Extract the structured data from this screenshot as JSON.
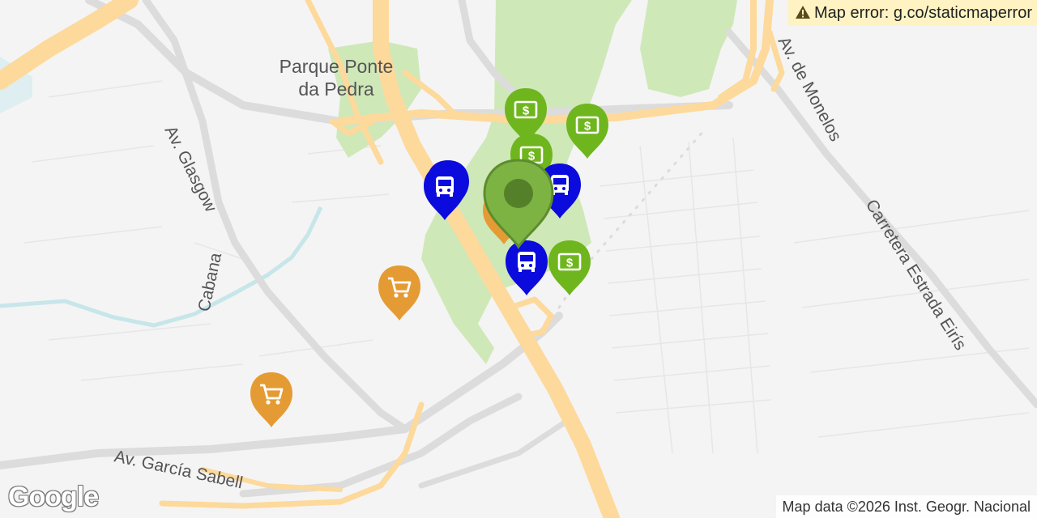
{
  "map": {
    "error_text": "Map error: g.co/staticmaperror",
    "attribution": "Map data ©2026 Inst. Geogr. Nacional",
    "logo_text": "Google",
    "park_label_line1": "Parque Ponte",
    "park_label_line2": "da Pedra",
    "streets": {
      "glasgow": "Av. Glasgow",
      "cabana": "Cabana",
      "garcia_sabell": "Av. García Sabell",
      "monelos": "Av. de Monelos",
      "eiris": "Carretera Estrada Eirís"
    },
    "colors": {
      "background": "#f4f4f4",
      "park": "#cfe8b8",
      "major_road": "#fdd99b",
      "minor_road": "#dcdcdc",
      "water": "#c7e6ea",
      "selected_marker": "#7cb342",
      "atm_marker": "#6fb61e",
      "bus_marker": "#0b0bdd",
      "shop_marker": "#e59b34",
      "error_banner": "#fff3c4"
    },
    "markers": [
      {
        "type": "selected",
        "icon": "location-pin-icon"
      },
      {
        "type": "atm",
        "icon": "dollar-icon"
      },
      {
        "type": "atm",
        "icon": "dollar-icon"
      },
      {
        "type": "atm",
        "icon": "dollar-icon"
      },
      {
        "type": "atm",
        "icon": "dollar-icon"
      },
      {
        "type": "bus",
        "icon": "bus-icon"
      },
      {
        "type": "bus",
        "icon": "bus-icon"
      },
      {
        "type": "bus",
        "icon": "bus-icon"
      },
      {
        "type": "shop",
        "icon": "shopping-cart-icon"
      },
      {
        "type": "shop",
        "icon": "shopping-cart-icon"
      }
    ]
  }
}
